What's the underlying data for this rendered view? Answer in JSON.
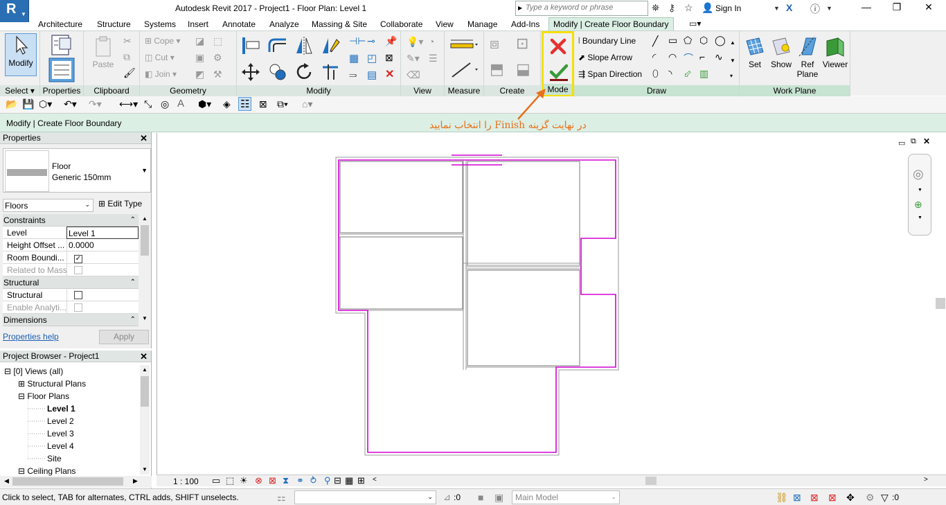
{
  "app": {
    "title": "Autodesk Revit 2017 -     Project1 - Floor Plan: Level 1",
    "logo": "R"
  },
  "search": {
    "placeholder": "Type a keyword or phrase"
  },
  "account": {
    "sign_in": "Sign In"
  },
  "tabs": [
    "Architecture",
    "Structure",
    "Systems",
    "Insert",
    "Annotate",
    "Analyze",
    "Massing & Site",
    "Collaborate",
    "View",
    "Manage",
    "Add-Ins",
    "Modify | Create Floor Boundary"
  ],
  "ribbon": {
    "select": {
      "modify": "Modify",
      "label": "Select"
    },
    "properties": {
      "label": "Properties"
    },
    "clipboard": {
      "paste": "Paste",
      "label": "Clipboard"
    },
    "geometry": {
      "cope": "Cope",
      "cut": "Cut",
      "join": "Join",
      "label": "Geometry"
    },
    "modify": {
      "label": "Modify"
    },
    "view": {
      "label": "View"
    },
    "measure": {
      "label": "Measure"
    },
    "create": {
      "label": "Create"
    },
    "mode": {
      "label": "Mode"
    },
    "draw": {
      "boundary_line": "Boundary Line",
      "slope_arrow": "Slope Arrow",
      "span_direction": "Span Direction",
      "label": "Draw"
    },
    "workplane": {
      "set": "Set",
      "show": "Show",
      "ref_plane_1": "Ref",
      "ref_plane_2": "Plane",
      "viewer": "Viewer",
      "label": "Work Plane"
    }
  },
  "optbar": {
    "label": "Modify | Create Floor Boundary"
  },
  "annotation": "در نهایت گزینه Finish را انتخاب نمایید",
  "properties": {
    "title": "Properties",
    "type_name": "Floor",
    "type_sub": "Generic 150mm",
    "category": "Floors",
    "edit_type": "Edit Type",
    "groups": {
      "constraints": "Constraints",
      "structural": "Structural",
      "dimensions": "Dimensions"
    },
    "rows": {
      "level_k": "Level",
      "level_v": "Level 1",
      "offset_k": "Height Offset ...",
      "offset_v": "0.0000",
      "room_k": "Room Boundi...",
      "mass_k": "Related to Mass",
      "struct_k": "Structural",
      "analytic_k": "Enable Analyti..."
    },
    "help": "Properties help",
    "apply": "Apply"
  },
  "browser": {
    "title": "Project Browser - Project1",
    "views": "Views (all)",
    "structural_plans": "Structural Plans",
    "floor_plans": "Floor Plans",
    "levels": [
      "Level 1",
      "Level 2",
      "Level 3",
      "Level 4",
      "Site"
    ],
    "ceiling_plans": "Ceiling Plans"
  },
  "view": {
    "scale": "1 : 100"
  },
  "status": {
    "text": "Click to select, TAB for alternates, CTRL adds, SHIFT unselects.",
    "count_a": ":0",
    "model": "Main Model",
    "count_b": ":0"
  },
  "colors": {
    "boundary": "#d400d4",
    "accent": "#f4e000",
    "annotation": "#e8701a"
  }
}
